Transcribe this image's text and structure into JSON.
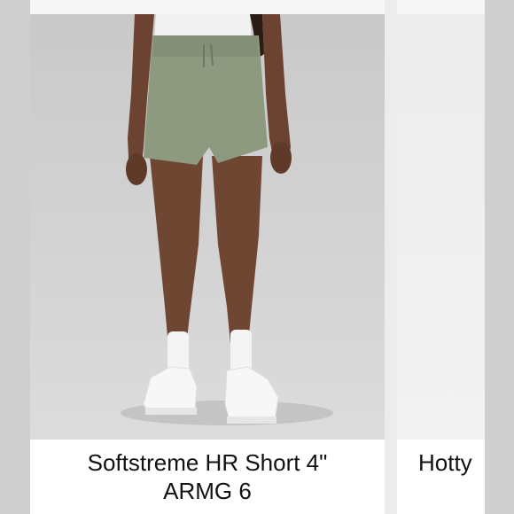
{
  "listings": [
    {
      "title_line1": "Softstreme HR Short 4\"",
      "title_line2": "ARMG 6",
      "image_alt": "model wearing sage green high-rise shorts with white socks and sneakers"
    },
    {
      "title_partial": "Hotty"
    }
  ],
  "colors": {
    "shorts": "#8e9a80",
    "background": "#d3d3d3"
  }
}
